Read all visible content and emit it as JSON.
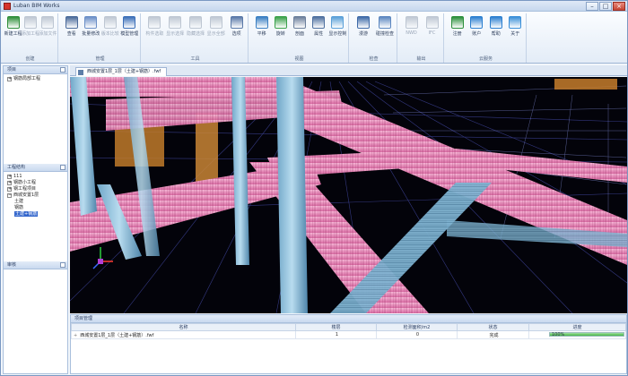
{
  "window": {
    "title": "Luban BIM Works",
    "minimize": "–",
    "maximize": "□",
    "close": "×"
  },
  "ribbon": {
    "groups": [
      {
        "title": "创建",
        "tools": [
          {
            "label": "新建工程",
            "icon": "new-project-icon",
            "enabled": true,
            "color": "#2f8f3a"
          },
          {
            "label": "添加工程",
            "icon": "add-project-icon",
            "enabled": false,
            "color": "#7a8aa0"
          },
          {
            "label": "添加文件",
            "icon": "add-file-icon",
            "enabled": false,
            "color": "#7a8aa0"
          }
        ]
      },
      {
        "title": "管理",
        "tools": [
          {
            "label": "查看",
            "icon": "view-icon",
            "enabled": true,
            "color": "#4a6a9a"
          },
          {
            "label": "批量修改",
            "icon": "batch-edit-icon",
            "enabled": true,
            "color": "#6b8fc7"
          },
          {
            "label": "版本比较",
            "icon": "version-compare-icon",
            "enabled": false,
            "color": "#7a8aa0"
          },
          {
            "label": "模型管理",
            "icon": "model-manage-icon",
            "enabled": true,
            "color": "#3b6fb8"
          }
        ]
      },
      {
        "title": "工具",
        "tools": [
          {
            "label": "构件选取",
            "icon": "select-icon",
            "enabled": false,
            "color": "#7a8aa0"
          },
          {
            "label": "显示选择",
            "icon": "show-selection-icon",
            "enabled": false,
            "color": "#7a8aa0"
          },
          {
            "label": "隐藏选择",
            "icon": "hide-selection-icon",
            "enabled": false,
            "color": "#7a8aa0"
          },
          {
            "label": "显示全部",
            "icon": "show-all-icon",
            "enabled": false,
            "color": "#7a8aa0"
          },
          {
            "label": "选项",
            "icon": "options-icon",
            "enabled": true,
            "color": "#5a79a8"
          }
        ]
      },
      {
        "title": "视图",
        "tools": [
          {
            "label": "平移",
            "icon": "pan-icon",
            "enabled": true,
            "color": "#3a7fc2"
          },
          {
            "label": "旋转",
            "icon": "rotate-icon",
            "enabled": true,
            "color": "#3aa14a"
          },
          {
            "label": "剖面",
            "icon": "section-icon",
            "enabled": true,
            "color": "#6b7f9c"
          },
          {
            "label": "属性",
            "icon": "properties-icon",
            "enabled": true,
            "color": "#4d6f9f"
          },
          {
            "label": "显示控制",
            "icon": "display-control-icon",
            "enabled": true,
            "color": "#5aa0d8"
          }
        ]
      },
      {
        "title": "检查",
        "tools": [
          {
            "label": "漫游",
            "icon": "walkthrough-icon",
            "enabled": true,
            "color": "#3e6aa8"
          },
          {
            "label": "碰撞检查",
            "icon": "clash-check-icon",
            "enabled": true,
            "color": "#5c87c0"
          }
        ]
      },
      {
        "title": "输出",
        "tools": [
          {
            "label": "NWD",
            "icon": "nwd-export-icon",
            "enabled": false,
            "color": "#7a8aa0"
          },
          {
            "label": "IFC",
            "icon": "ifc-export-icon",
            "enabled": false,
            "color": "#7a8aa0"
          }
        ]
      },
      {
        "title": "云服务",
        "tools": [
          {
            "label": "注册",
            "icon": "register-icon",
            "enabled": true,
            "color": "#2a8f3a"
          },
          {
            "label": "账户",
            "icon": "account-icon",
            "enabled": true,
            "color": "#2b7fd0"
          },
          {
            "label": "帮助",
            "icon": "help-icon",
            "enabled": true,
            "color": "#2b7fd0"
          },
          {
            "label": "关于",
            "icon": "about-icon",
            "enabled": true,
            "color": "#3a8fd8"
          }
        ]
      }
    ]
  },
  "left_panels": {
    "projects": {
      "title": "项目",
      "items": [
        {
          "label": "钢筋局部工程",
          "expander": "+"
        }
      ]
    },
    "structure": {
      "title": "工程结构",
      "items": [
        {
          "label": "111",
          "level": 0,
          "expander": "+"
        },
        {
          "label": "钢筋小工程",
          "level": 0,
          "expander": "+"
        },
        {
          "label": "钢工程项目",
          "level": 0,
          "expander": "+"
        },
        {
          "label": "西城安置1层",
          "level": 0,
          "expander": "−"
        },
        {
          "label": "土建",
          "level": 1,
          "expander": ""
        },
        {
          "label": "钢筋",
          "level": 1,
          "expander": ""
        },
        {
          "label": "土建+钢筋",
          "level": 1,
          "expander": "",
          "selected": true
        }
      ]
    },
    "third": {
      "title": "审核"
    }
  },
  "document": {
    "tab_label": "西城安置1层_1层（土建+钢筋）.fwf"
  },
  "bottom_panel": {
    "title": "项目管理",
    "columns": [
      "名称",
      "楼层",
      "检测面积/m2",
      "状态",
      "进度"
    ],
    "rows": [
      {
        "name": "西城安置1层_1层（土建+钢筋）.fwf",
        "floor": "1",
        "area": "0",
        "status": "完成",
        "progress_label": "100%",
        "progress": 1.0
      }
    ]
  }
}
